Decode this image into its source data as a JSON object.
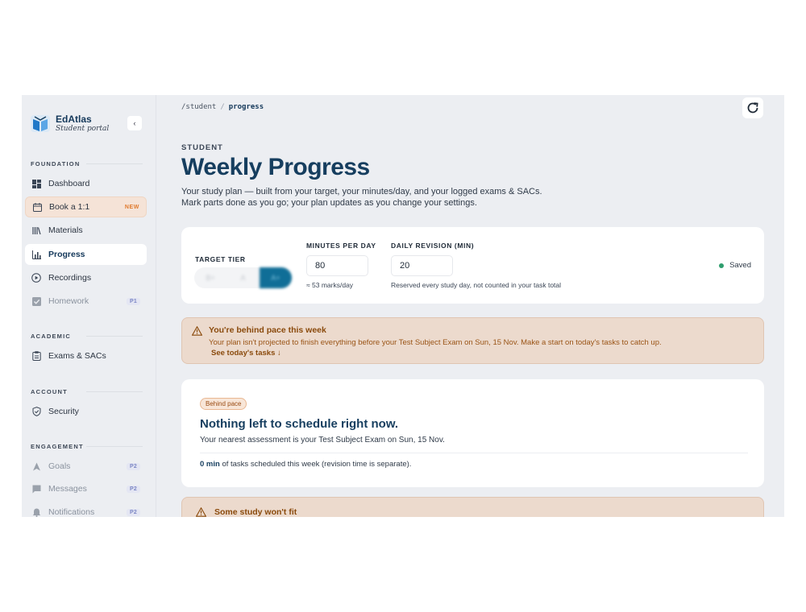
{
  "brand": {
    "name": "EdAtlas",
    "subtitle": "Student portal"
  },
  "sidebar": {
    "collapse_icon": "‹",
    "sections": {
      "foundation": "FOUNDATION",
      "academic": "ACADEMIC",
      "account": "ACCOUNT",
      "engagement": "ENGAGEMENT"
    },
    "items": {
      "dashboard": {
        "label": "Dashboard"
      },
      "book": {
        "label": "Book a 1:1",
        "badge": "NEW"
      },
      "materials": {
        "label": "Materials"
      },
      "progress": {
        "label": "Progress"
      },
      "recordings": {
        "label": "Recordings"
      },
      "homework": {
        "label": "Homework",
        "badge": "P1"
      },
      "exams": {
        "label": "Exams & SACs"
      },
      "security": {
        "label": "Security"
      },
      "goals": {
        "label": "Goals",
        "badge": "P2"
      },
      "messages": {
        "label": "Messages",
        "badge": "P2"
      },
      "notifications": {
        "label": "Notifications",
        "badge": "P2"
      }
    }
  },
  "breadcrumb": {
    "root": "/student",
    "separator": "/",
    "current": "progress"
  },
  "header": {
    "eyebrow": "STUDENT",
    "title": "Weekly Progress",
    "intro_line1": "Your study plan — built from your target, your minutes/day, and your logged exams & SACs.",
    "intro_line2": "Mark parts done as you go; your plan updates as you change your settings."
  },
  "settings": {
    "target_tier_label": "TARGET TIER",
    "tiers": [
      "B+",
      "A",
      "A+"
    ],
    "minutes_label": "MINUTES PER DAY",
    "minutes_value": "80",
    "minutes_hint": "≈ 53 marks/day",
    "revision_label": "DAILY REVISION (MIN)",
    "revision_value": "20",
    "revision_hint": "Reserved every study day, not counted in your task total",
    "saved_label": "Saved"
  },
  "alert_behind": {
    "title": "You're behind pace this week",
    "body": "Your plan isn't projected to finish everything before your Test Subject Exam on Sun, 15 Nov. Make a start on today's tasks to catch up.",
    "link": "See today's tasks ↓"
  },
  "status": {
    "pill": "Behind pace",
    "title": "Nothing left to schedule right now.",
    "subtitle": "Your nearest assessment is your Test Subject Exam on Sun, 15 Nov.",
    "minutes": "0 min",
    "minutes_note": " of tasks scheduled this week (revision time is separate)."
  },
  "alert_fit": {
    "title": "Some study won't fit"
  },
  "colors": {
    "brand": "#163e5f",
    "accent": "#106e97",
    "warning_bg": "#ecdacd",
    "warning_text": "#8a4a0c",
    "saved_dot": "#2f9e6e"
  }
}
